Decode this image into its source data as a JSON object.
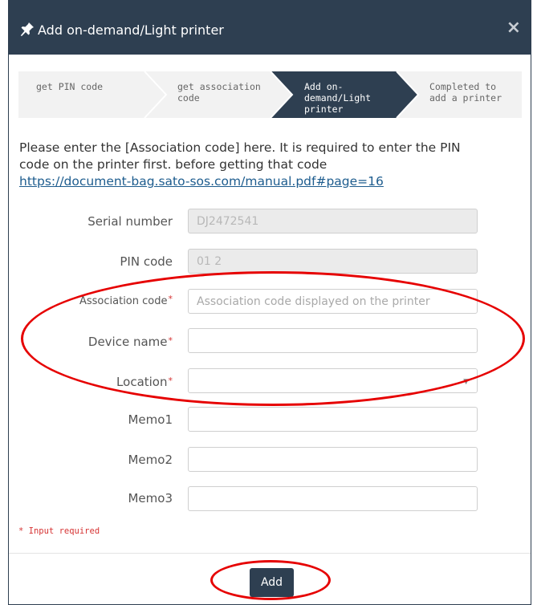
{
  "dialog": {
    "title": "Add on-demand/Light printer",
    "close_glyph": "×"
  },
  "icons": {
    "title_icon": "pin-icon",
    "close_icon": "close-icon",
    "select_icon": "caret-down-icon"
  },
  "steps": [
    {
      "line1": "get PIN code",
      "line2": "",
      "line3": "",
      "active": false
    },
    {
      "line1": "get association",
      "line2": "code",
      "line3": "",
      "active": false
    },
    {
      "line1": "Add on-",
      "line2": "demand/Light",
      "line3": "printer",
      "active": true
    },
    {
      "line1": "Completed to",
      "line2": "add a printer",
      "line3": "",
      "active": false
    }
  ],
  "intro": {
    "text_line1": "Please enter the [Association code] here. It is required to enter the PIN",
    "text_line2": "code on the printer first. before getting that code",
    "link": "https://document-bag.sato-sos.com/manual.pdf#page=16"
  },
  "form": {
    "serial": {
      "label": "Serial number",
      "value": "DJ2472541"
    },
    "pin": {
      "label": "PIN code",
      "value": "01 2"
    },
    "association": {
      "label": "Association code",
      "placeholder": "Association code displayed on the printer"
    },
    "device": {
      "label": "Device name",
      "value": ""
    },
    "location": {
      "label": "Location",
      "value": ""
    },
    "memo1": {
      "label": "Memo1",
      "value": ""
    },
    "memo2": {
      "label": "Memo2",
      "value": ""
    },
    "memo3": {
      "label": "Memo3",
      "value": ""
    },
    "required_marker": "*"
  },
  "footer": {
    "required_note": "* Input required",
    "add_label": "Add"
  },
  "colors": {
    "header_bg": "#2e3f51",
    "step_inactive": "#f2f2f2",
    "step_active": "#2e3f51",
    "required": "#d63333",
    "annotation": "#e60000"
  }
}
